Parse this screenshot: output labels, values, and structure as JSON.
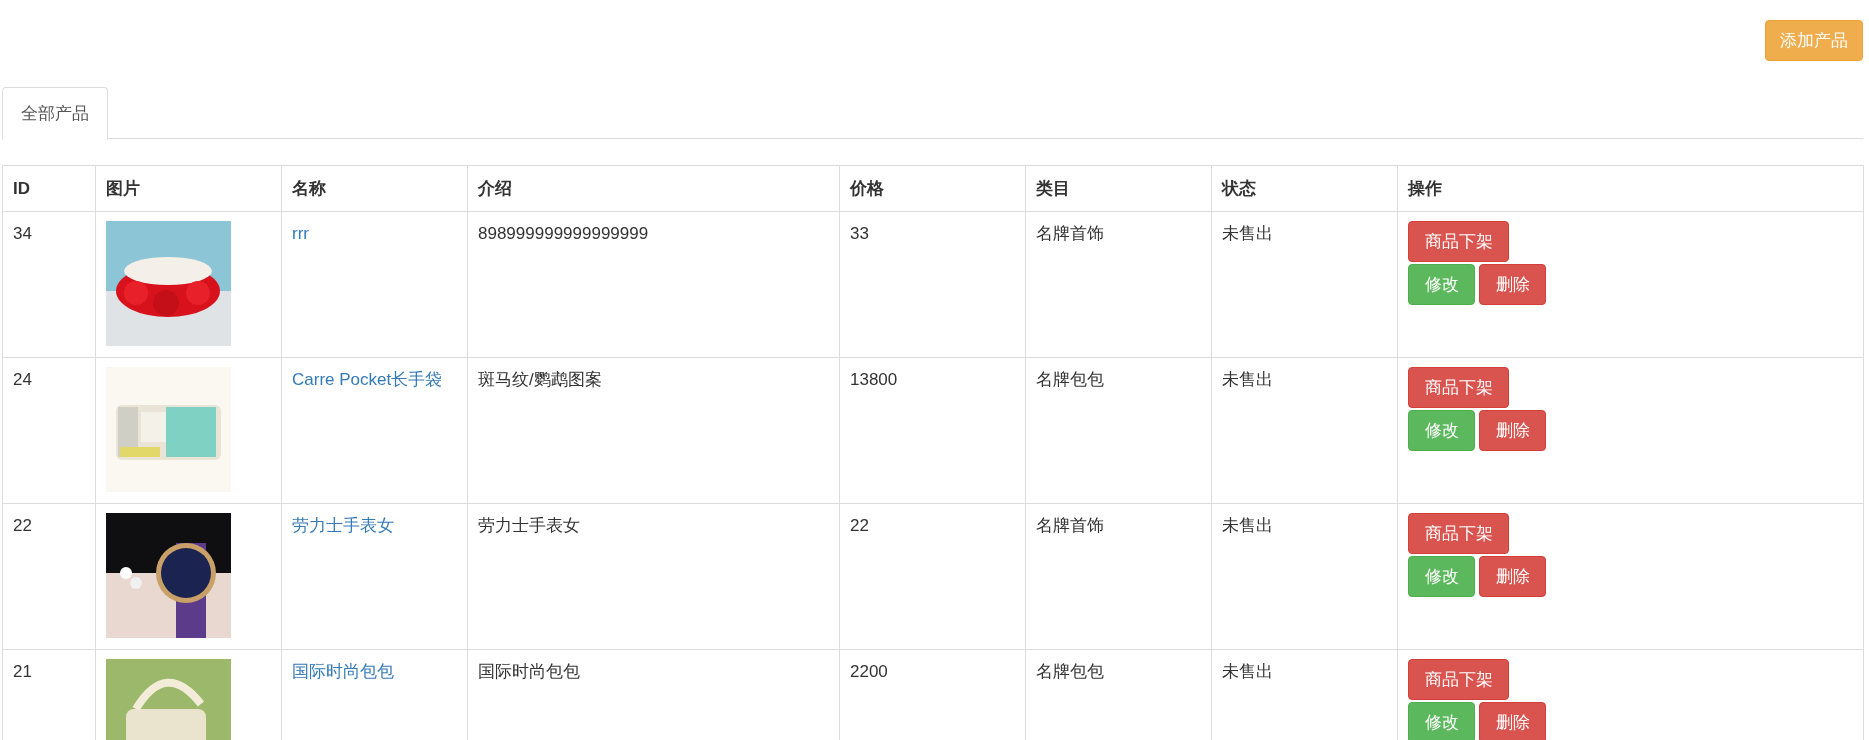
{
  "add_button": "添加产品",
  "tabs": [
    {
      "label": "全部产品",
      "selected": true
    }
  ],
  "table": {
    "columns": [
      "ID",
      "图片",
      "名称",
      "介绍",
      "价格",
      "类目",
      "状态",
      "操作"
    ],
    "rows": [
      {
        "id": "34",
        "image": {
          "kind": "picture"
        },
        "name": "rrr",
        "description": "898999999999999999",
        "price": "33",
        "category": "名牌首饰",
        "status": "未售出",
        "actions": [
          "商品下架",
          "修改",
          "删除"
        ]
      },
      {
        "id": "24",
        "image": {
          "kind": "picture"
        },
        "name": "Carre Pocket长手袋",
        "description": "斑马纹/鹦鹉图案",
        "price": "13800",
        "category": "名牌包包",
        "status": "未售出",
        "actions": [
          "商品下架",
          "修改",
          "删除"
        ]
      },
      {
        "id": "22",
        "image": {
          "kind": "picture"
        },
        "name": "劳力士手表女",
        "description": "劳力士手表女",
        "price": "22",
        "category": "名牌首饰",
        "status": "未售出",
        "actions": [
          "商品下架",
          "修改",
          "删除"
        ]
      },
      {
        "id": "21",
        "image": {
          "kind": "picture"
        },
        "name": "国际时尚包包",
        "description": "国际时尚包包",
        "price": "2200",
        "category": "名牌包包",
        "status": "未售出",
        "actions": [
          "商品下架",
          "修改",
          "删除"
        ]
      }
    ]
  }
}
